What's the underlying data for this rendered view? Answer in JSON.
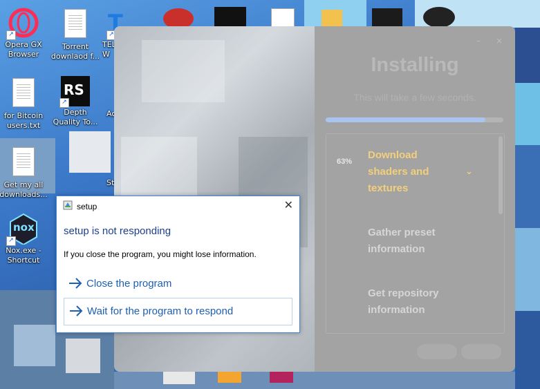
{
  "desktop": {
    "icons": [
      {
        "label": "Opera GX\nBrowser"
      },
      {
        "label": "Torrent\ndownlaod f..."
      },
      {
        "label": "TEL\nW"
      },
      {
        "label": "for Bitcoin\nusers.txt"
      },
      {
        "label": "Depth\nQuality To..."
      },
      {
        "label": "Ac"
      },
      {
        "label": "Get my all\ndownloads..."
      },
      {
        "label": "St"
      },
      {
        "label": "Nox.exe -\nShortcut"
      }
    ],
    "rs_badge": "RS",
    "nox_badge": "nox"
  },
  "installer": {
    "title": "Installing",
    "subtitle": "This will take a few seconds.",
    "progress": 0.9,
    "steps": [
      {
        "label": "Download shaders and textures",
        "percent": "63%",
        "state": "active"
      },
      {
        "label": "Gather preset information",
        "state": "pending"
      },
      {
        "label": "Get repository information",
        "state": "pending"
      }
    ]
  },
  "dialog": {
    "window_title": "setup",
    "heading": "setup is not responding",
    "message": "If you close the program, you might lose information.",
    "options": [
      {
        "label": "Close the program"
      },
      {
        "label": "Wait for the program to respond"
      }
    ],
    "close_glyph": "✕"
  },
  "colors": {
    "accent": "#1c5fb3",
    "active_step": "#f2cf7a",
    "progress_fill": "#a9c4ee"
  }
}
